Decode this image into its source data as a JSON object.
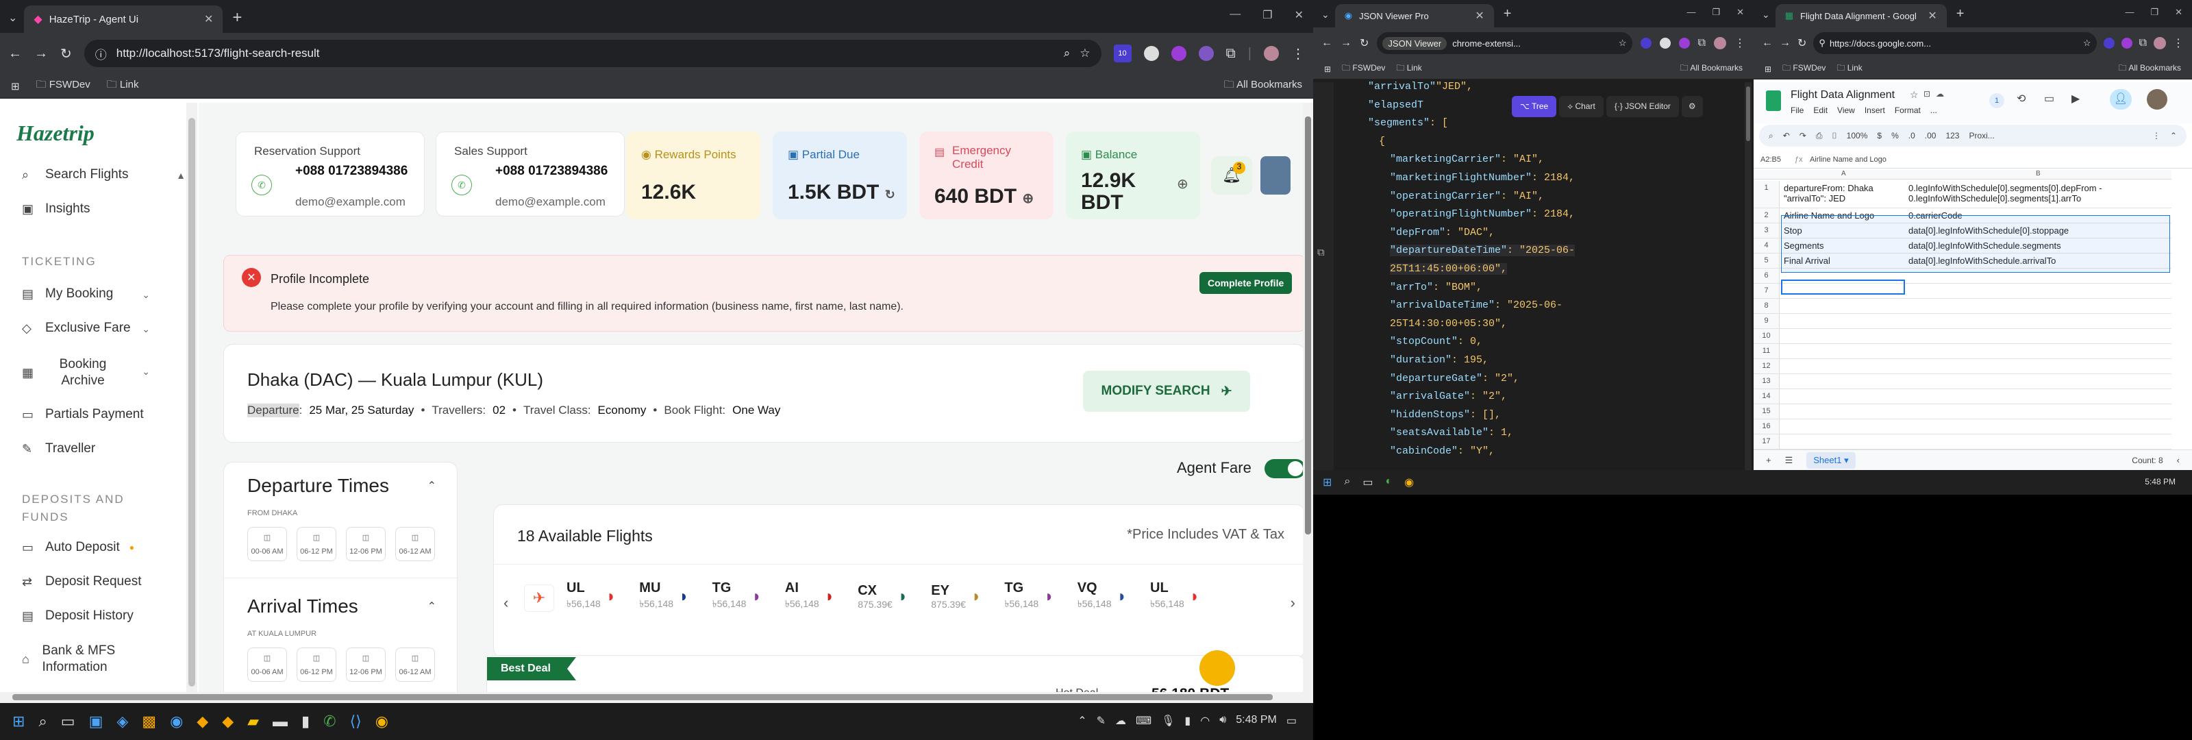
{
  "left_browser": {
    "tab_title": "HazeTrip - Agent Ui",
    "url": "http://localhost:5173/flight-search-result",
    "bookmarks": [
      "FSWDev",
      "Link"
    ],
    "all_bookmarks": "All Bookmarks",
    "ext_badge": "10"
  },
  "app": {
    "logo": "Hazetrip",
    "sidebar": {
      "search": "Search Flights",
      "insights": "Insights",
      "ticketing_head": "TICKETING",
      "my_booking": "My Booking",
      "exclusive_fare": "Exclusive Fare",
      "booking_archive": "Booking Archive",
      "partials_payment": "Partials Payment",
      "traveller": "Traveller",
      "deposits_head": "DEPOSITS AND FUNDS",
      "auto_deposit": "Auto Deposit",
      "deposit_request": "Deposit Request",
      "deposit_history": "Deposit History",
      "bank_mfs": "Bank & MFS Information"
    },
    "reservation": {
      "title": "Reservation Support",
      "phone": "+088 01723894386",
      "email": "demo@example.com"
    },
    "sales": {
      "title": "Sales Support",
      "phone": "+088 01723894386",
      "email": "demo@example.com"
    },
    "rewards": {
      "label": "Rewards Points",
      "value": "12.6K"
    },
    "partial_due": {
      "label": "Partial Due",
      "value": "1.5K BDT"
    },
    "emergency": {
      "label": "Emergency Credit",
      "value": "640 BDT"
    },
    "balance": {
      "label": "Balance",
      "value": "12.9K BDT"
    },
    "notif_count": "3",
    "alert": {
      "title": "Profile Incomplete",
      "message": "Please complete your profile by verifying your account and filling in all required information (business name, first name, last name).",
      "button": "Complete Profile"
    },
    "route": {
      "title": "Dhaka (DAC) — Kuala Lumpur (KUL)",
      "departure_label": "Departure",
      "departure": "25 Mar, 25 Saturday",
      "travellers_label": "Travellers:",
      "travellers": "02",
      "class_label": "Travel Class:",
      "class": "Economy",
      "book_label": "Book Flight:",
      "book": "One Way",
      "modify": "MODIFY SEARCH"
    },
    "agent_fare": "Agent Fare",
    "filters": {
      "departure_title": "Departure Times",
      "from": "FROM DHAKA",
      "arrival_title": "Arrival Times",
      "at": "AT KUALA LUMPUR",
      "slots": [
        "00-06 AM",
        "06-12 PM",
        "12-06 PM",
        "06-12 AM"
      ]
    },
    "results": {
      "count": "18 Available Flights",
      "vat_note": "*Price Includes VAT & Tax",
      "best_deal": "Best Deal",
      "hot_deal": "Hot Deal",
      "hot_price": "56,180 BDT"
    },
    "airlines": [
      {
        "code": "UL",
        "price": "৳56,148"
      },
      {
        "code": "MU",
        "price": "৳56,148"
      },
      {
        "code": "TG",
        "price": "৳56,148"
      },
      {
        "code": "AI",
        "price": "৳56,148"
      },
      {
        "code": "CX",
        "price": "875.39€"
      },
      {
        "code": "EY",
        "price": "875.39€"
      },
      {
        "code": "TG",
        "price": "৳56,148"
      },
      {
        "code": "VQ",
        "price": "৳56,148"
      },
      {
        "code": "UL",
        "price": "৳56,148"
      }
    ]
  },
  "json_viewer": {
    "tab_title": "JSON Viewer Pro",
    "url_title": "JSON Viewer",
    "url_rest": "chrome-extensi...",
    "bookmarks": [
      "FSWDev",
      "Link"
    ],
    "all_bookmarks": "All Bookmarks",
    "toolbar": {
      "tree": "Tree",
      "chart": "Chart",
      "editor": "JSON Editor"
    },
    "lines": [
      {
        "k": "\"arrivalTo\"",
        "v": "\"JED\","
      },
      {
        "k": "\"elapsedT",
        "v": ""
      },
      {
        "k": "\"segments\"",
        "v": ": ["
      },
      {
        "k": "",
        "v": "{"
      },
      {
        "k": "\"marketingCarrier\"",
        "v": ": \"AI\","
      },
      {
        "k": "\"marketingFlightNumber\"",
        "v": ": 2184,"
      },
      {
        "k": "\"operatingCarrier\"",
        "v": ": \"AI\","
      },
      {
        "k": "\"operatingFlightNumber\"",
        "v": ": 2184,"
      },
      {
        "k": "\"depFrom\"",
        "v": ": \"DAC\","
      },
      {
        "k": "\"departureDateTime\"",
        "v": ": \"2025-06-"
      },
      {
        "k": "",
        "v": "25T11:45:00+06:00\","
      },
      {
        "k": "\"arrTo\"",
        "v": ": \"BOM\","
      },
      {
        "k": "\"arrivalDateTime\"",
        "v": ": \"2025-06-"
      },
      {
        "k": "",
        "v": "25T14:30:00+05:30\","
      },
      {
        "k": "\"stopCount\"",
        "v": ": 0,"
      },
      {
        "k": "\"duration\"",
        "v": ": 195,"
      },
      {
        "k": "\"departureGate\"",
        "v": ": \"2\","
      },
      {
        "k": "\"arrivalGate\"",
        "v": ": \"2\","
      },
      {
        "k": "\"hiddenStops\"",
        "v": ": [],"
      },
      {
        "k": "\"seatsAvailable\"",
        "v": ": 1,"
      },
      {
        "k": "\"cabinCode\"",
        "v": ": \"Y\","
      }
    ]
  },
  "sheets": {
    "tab_title": "Flight Data Alignment - Googl",
    "url": "https://docs.google.com...",
    "bookmarks": [
      "FSWDev",
      "Link"
    ],
    "all_bookmarks": "All Bookmarks",
    "doc_title": "Flight Data Alignment",
    "menu": [
      "File",
      "Edit",
      "View",
      "Insert",
      "Format",
      "..."
    ],
    "zoom": "100%",
    "font": "Proxi...",
    "cell_ref": "A2:B5",
    "formula": "Airline Name and Logo",
    "sheet_tab": "Sheet1",
    "count": "Count: 8",
    "rows": [
      {
        "n": "1",
        "a": "departureFrom: Dhaka \"arrivalTo\": JED",
        "b": "0.legInfoWithSchedule[0].segments[0].depFrom - 0.legInfoWithSchedule[0].segments[1].arrTo"
      },
      {
        "n": "2",
        "a": "Airline Name and Logo",
        "b": "0.carrierCode"
      },
      {
        "n": "3",
        "a": "Stop",
        "b": "data[0].legInfoWithSchedule[0].stoppage"
      },
      {
        "n": "4",
        "a": "Segments",
        "b": "data[0].legInfoWithSchedule.segments"
      },
      {
        "n": "5",
        "a": "Final Arrival",
        "b": "data[0].legInfoWithSchedule.arrivalTo"
      },
      {
        "n": "6",
        "a": "",
        "b": ""
      },
      {
        "n": "7",
        "a": "",
        "b": ""
      },
      {
        "n": "8",
        "a": "",
        "b": ""
      },
      {
        "n": "9",
        "a": "",
        "b": ""
      },
      {
        "n": "10",
        "a": "",
        "b": ""
      },
      {
        "n": "11",
        "a": "",
        "b": ""
      },
      {
        "n": "12",
        "a": "",
        "b": ""
      },
      {
        "n": "13",
        "a": "",
        "b": ""
      },
      {
        "n": "14",
        "a": "",
        "b": ""
      },
      {
        "n": "15",
        "a": "",
        "b": ""
      },
      {
        "n": "16",
        "a": "",
        "b": ""
      },
      {
        "n": "17",
        "a": "",
        "b": ""
      },
      {
        "n": "18",
        "a": "",
        "b": ""
      }
    ]
  },
  "taskbar": {
    "time": "5:48 PM"
  }
}
